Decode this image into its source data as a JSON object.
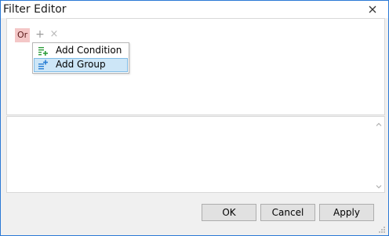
{
  "window": {
    "title": "Filter Editor",
    "icons": {
      "close": "close-icon"
    }
  },
  "filter": {
    "group_operator": "Or",
    "add_symbol": "+",
    "remove_symbol": "×"
  },
  "context_menu": {
    "items": [
      {
        "label": "Add Condition",
        "icon": "add-condition-icon",
        "selected": false
      },
      {
        "label": "Add Group",
        "icon": "add-group-icon",
        "selected": true
      }
    ]
  },
  "buttons": {
    "ok": "OK",
    "cancel": "Cancel",
    "apply": "Apply"
  },
  "colors": {
    "accent_border": "#2b79d6",
    "group_operator_bg": "#f4c7c7",
    "menu_selected_bg": "#cde6f7",
    "icon_green": "#2e9e3c",
    "icon_blue": "#2a7fd4"
  }
}
